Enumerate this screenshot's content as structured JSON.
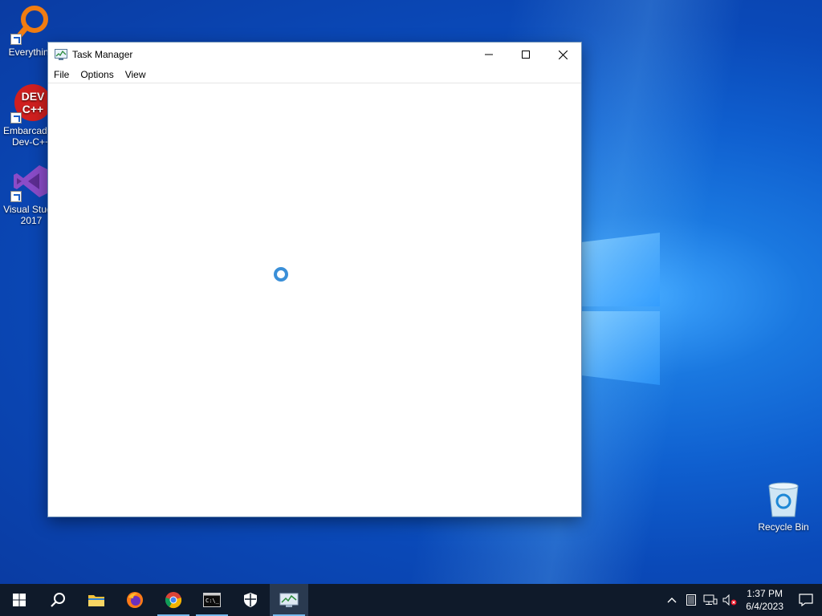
{
  "desktop": {
    "icons": [
      {
        "label": "Everything"
      },
      {
        "label": "Embarcadero Dev-C++"
      },
      {
        "label": "Visual Studio 2017"
      },
      {
        "label": "Recycle Bin"
      }
    ]
  },
  "window": {
    "title": "Task Manager",
    "menu": [
      {
        "label": "File"
      },
      {
        "label": "Options"
      },
      {
        "label": "View"
      }
    ],
    "minimize_icon": "minimize-icon",
    "maximize_icon": "maximize-icon",
    "close_icon": "close-icon"
  },
  "taskbar": {
    "buttons": [
      {
        "icon": "windows-start-icon"
      },
      {
        "icon": "search-icon"
      },
      {
        "icon": "file-explorer-icon"
      },
      {
        "icon": "firefox-icon"
      },
      {
        "icon": "chrome-icon"
      },
      {
        "icon": "terminal-icon"
      },
      {
        "icon": "windows-security-icon"
      },
      {
        "icon": "task-manager-icon",
        "active": true
      }
    ],
    "clock": {
      "time": "1:37 PM",
      "date": "6/4/2023"
    }
  },
  "colors": {
    "accent": "#3a8fd8",
    "taskbar": "#0f1a2a"
  }
}
